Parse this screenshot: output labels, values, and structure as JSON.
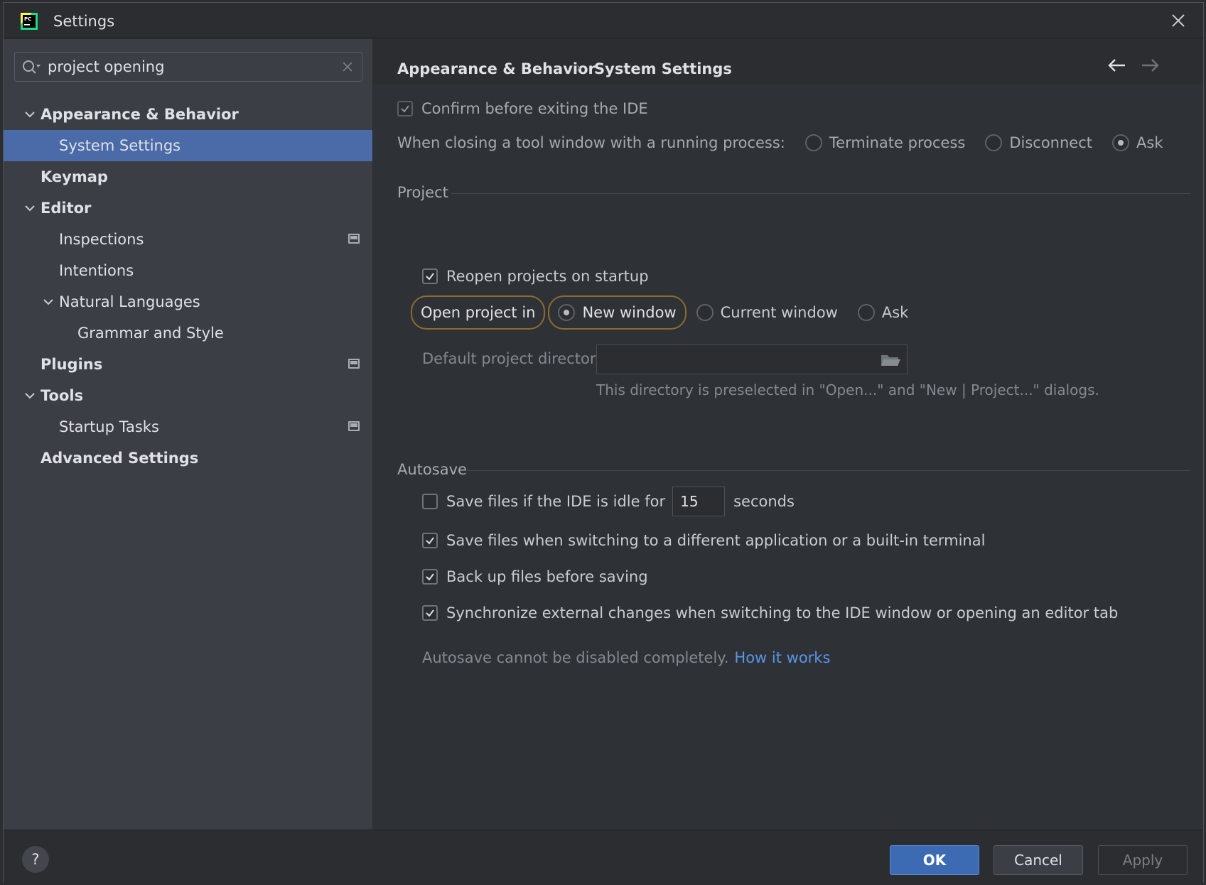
{
  "window": {
    "title": "Settings"
  },
  "search": {
    "value": "project opening"
  },
  "sidebar": {
    "items": [
      {
        "label": "Appearance & Behavior"
      },
      {
        "label": "System Settings"
      },
      {
        "label": "Keymap"
      },
      {
        "label": "Editor"
      },
      {
        "label": "Inspections"
      },
      {
        "label": "Intentions"
      },
      {
        "label": "Natural Languages"
      },
      {
        "label": "Grammar and Style"
      },
      {
        "label": "Plugins"
      },
      {
        "label": "Tools"
      },
      {
        "label": "Startup Tasks"
      },
      {
        "label": "Advanced Settings"
      }
    ]
  },
  "breadcrumb": {
    "parent": "Appearance & Behavior",
    "separator": "›",
    "current": "System Settings"
  },
  "general": {
    "confirm_exit": {
      "label": "Confirm before exiting the IDE",
      "checked": true
    },
    "closing_label": "When closing a tool window with a running process:",
    "closing_options": [
      {
        "label": "Terminate process",
        "selected": false
      },
      {
        "label": "Disconnect",
        "selected": false
      },
      {
        "label": "Ask",
        "selected": true
      }
    ]
  },
  "project": {
    "section_title": "Project",
    "reopen": {
      "label": "Reopen projects on startup",
      "checked": true
    },
    "open_in_label": "Open project in",
    "open_in_options": [
      {
        "label": "New window",
        "selected": true
      },
      {
        "label": "Current window",
        "selected": false
      },
      {
        "label": "Ask",
        "selected": false
      }
    ],
    "default_dir_label": "Default project directory:",
    "default_dir_value": "",
    "default_dir_hint": "This directory is preselected in \"Open...\" and \"New | Project...\" dialogs."
  },
  "autosave": {
    "section_title": "Autosave",
    "idle": {
      "label_before": "Save files if the IDE is idle for",
      "value": "15",
      "label_after": "seconds",
      "checked": false
    },
    "switch_app": {
      "label": "Save files when switching to a different application or a built-in terminal",
      "checked": true
    },
    "backup": {
      "label": "Back up files before saving",
      "checked": true
    },
    "sync": {
      "label": "Synchronize external changes when switching to the IDE window or opening an editor tab",
      "checked": true
    },
    "note": "Autosave cannot be disabled completely.",
    "link": "How it works"
  },
  "footer": {
    "help": "?",
    "ok": "OK",
    "cancel": "Cancel",
    "apply": "Apply"
  },
  "colors": {
    "selection": "#4a6aa8",
    "ok_button": "#3d6bb3",
    "link": "#5a95e8",
    "highlight_outline": "#8a6d2e"
  }
}
